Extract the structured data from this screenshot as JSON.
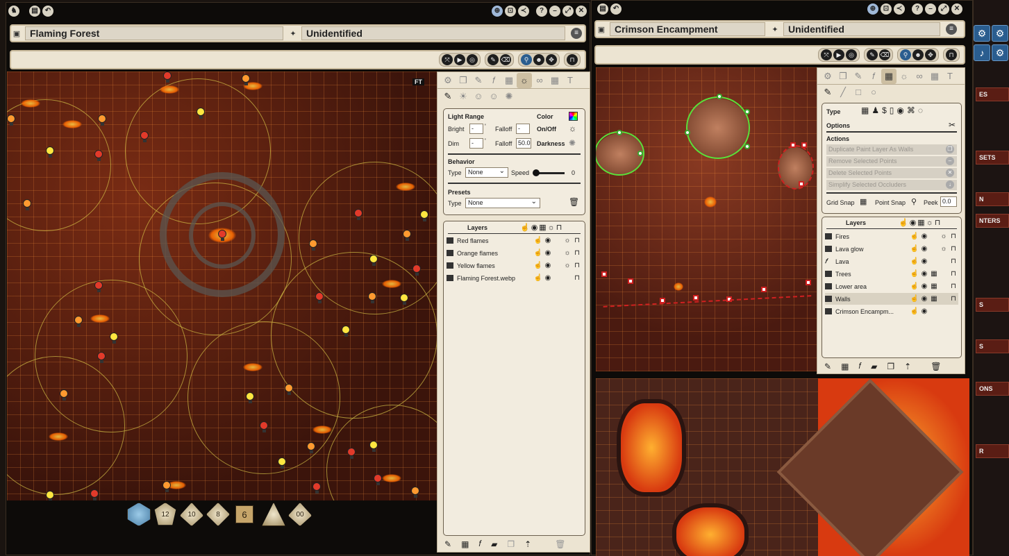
{
  "left_window": {
    "title_icon": "map-icon",
    "name": "Flaming Forest",
    "nonid_name": "Unidentified",
    "ft_label": "FT",
    "map_colors": {
      "lava": "#7a2c14",
      "grid": "#ff9640",
      "ring": "#d2be46"
    }
  },
  "right_window": {
    "name": "Crimson Encampment",
    "nonid_name": "Unidentified"
  },
  "lighting_panel": {
    "light_range": "Light Range",
    "color": "Color",
    "bright": "Bright",
    "bright_val": "-",
    "falloff": "Falloff",
    "falloff_val": "-",
    "onoff": "On/Off",
    "dim": "Dim",
    "dim_val": "-",
    "falloff2": "Falloff",
    "falloff2_val": "50.0",
    "darkness": "Darkness",
    "behavior": "Behavior",
    "type": "Type",
    "type_val": "None",
    "speed": "Speed",
    "speed_val": "0",
    "presets": "Presets",
    "preset_type": "Type",
    "preset_val": "None",
    "layers_title": "Layers",
    "layers": [
      {
        "name": "Red flames"
      },
      {
        "name": "Orange flames"
      },
      {
        "name": "Yellow flames"
      },
      {
        "name": "Flaming Forest.webp"
      }
    ]
  },
  "walls_panel": {
    "type": "Type",
    "options": "Options",
    "actions": "Actions",
    "actions_list": [
      "Duplicate Paint Layer As Walls",
      "Remove Selected Points",
      "Delete Selected Points",
      "Simplify Selected Occluders"
    ],
    "grid_snap": "Grid Snap",
    "point_snap": "Point Snap",
    "peek": "Peek",
    "peek_val": "0.0",
    "layers_title": "Layers",
    "layers": [
      {
        "name": "Fires",
        "icon": "image"
      },
      {
        "name": "Lava glow",
        "icon": "image"
      },
      {
        "name": "Lava",
        "icon": "fx"
      },
      {
        "name": "Trees",
        "icon": "image"
      },
      {
        "name": "Lower area",
        "icon": "image"
      },
      {
        "name": "Walls",
        "icon": "image"
      },
      {
        "name": "Crimson Encampm...",
        "icon": "image"
      }
    ]
  },
  "dice": [
    "",
    "12",
    "10",
    "8",
    "6",
    "",
    "00"
  ],
  "sidebar_tabs": [
    "ES",
    "SETS",
    "N",
    "NTERS",
    "S",
    "S",
    "ONS",
    "R"
  ]
}
